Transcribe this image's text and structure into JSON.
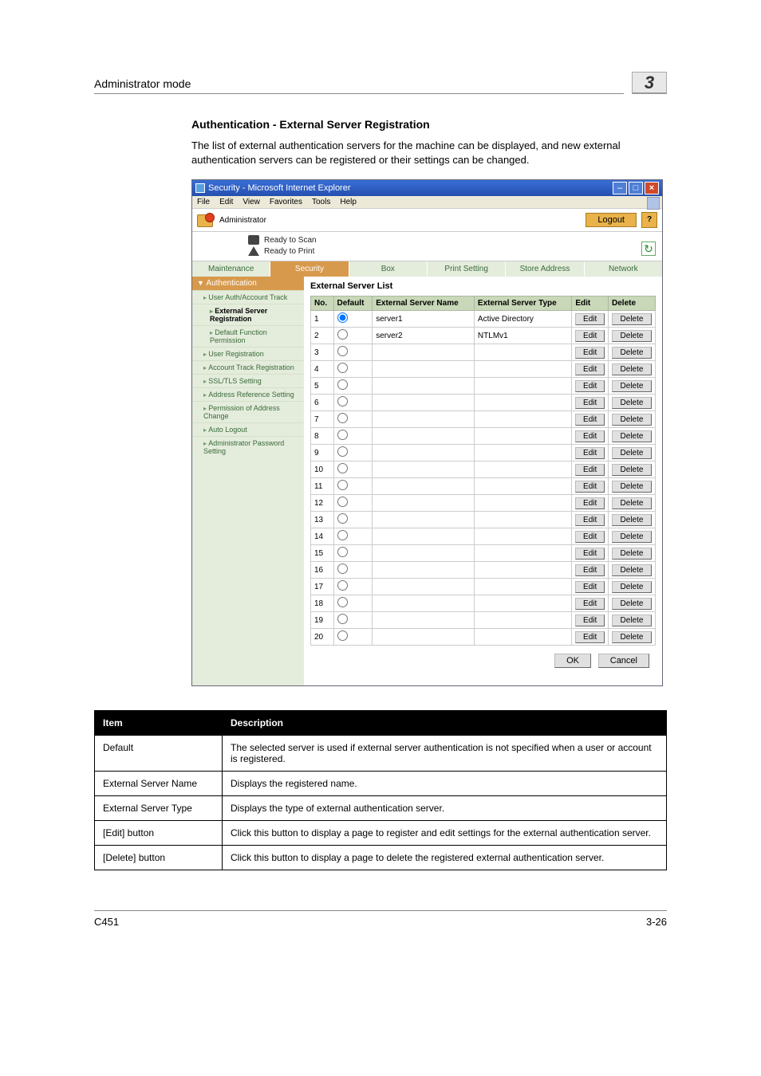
{
  "header": {
    "mode_title": "Administrator mode",
    "chapter": "3"
  },
  "section": {
    "title": "Authentication - External Server Registration",
    "intro": "The list of external authentication servers for the machine can be displayed, and new external authentication servers can be registered or their settings can be changed."
  },
  "iewin": {
    "title": "Security - Microsoft Internet Explorer",
    "menus": [
      "File",
      "Edit",
      "View",
      "Favorites",
      "Tools",
      "Help"
    ],
    "top": {
      "admin_label": "Administrator",
      "logout": "Logout",
      "help_label": "?"
    },
    "status": {
      "scan": "Ready to Scan",
      "print": "Ready to Print",
      "refresh": "↻"
    },
    "tabs": {
      "items": [
        "Maintenance",
        "Security",
        "Box",
        "Print Setting",
        "Store Address",
        "Network"
      ],
      "active": 1
    },
    "sidenav": {
      "header": "Authentication",
      "items": [
        {
          "label": "User Auth/Account Track",
          "sub": false,
          "active": false
        },
        {
          "label": "External Server Registration",
          "sub": true,
          "active": true
        },
        {
          "label": "Default Function Permission",
          "sub": true,
          "active": false
        },
        {
          "label": "User Registration",
          "sub": false,
          "active": false
        },
        {
          "label": "Account Track Registration",
          "sub": false,
          "active": false
        },
        {
          "label": "SSL/TLS Setting",
          "sub": false,
          "active": false
        },
        {
          "label": "Address Reference Setting",
          "sub": false,
          "active": false
        },
        {
          "label": "Permission of Address Change",
          "sub": false,
          "active": false
        },
        {
          "label": "Auto Logout",
          "sub": false,
          "active": false
        },
        {
          "label": "Administrator Password Setting",
          "sub": false,
          "active": false
        }
      ]
    },
    "detail": {
      "title": "External Server List",
      "cols": {
        "no": "No.",
        "def": "Default",
        "name": "External Server Name",
        "type": "External Server Type",
        "edit": "Edit",
        "del": "Delete"
      },
      "edit_label": "Edit",
      "delete_label": "Delete",
      "rows": [
        {
          "no": 1,
          "selected": true,
          "name": "server1",
          "type": "Active Directory"
        },
        {
          "no": 2,
          "selected": false,
          "name": "server2",
          "type": "NTLMv1"
        },
        {
          "no": 3,
          "selected": false,
          "name": "",
          "type": ""
        },
        {
          "no": 4,
          "selected": false,
          "name": "",
          "type": ""
        },
        {
          "no": 5,
          "selected": false,
          "name": "",
          "type": ""
        },
        {
          "no": 6,
          "selected": false,
          "name": "",
          "type": ""
        },
        {
          "no": 7,
          "selected": false,
          "name": "",
          "type": ""
        },
        {
          "no": 8,
          "selected": false,
          "name": "",
          "type": ""
        },
        {
          "no": 9,
          "selected": false,
          "name": "",
          "type": ""
        },
        {
          "no": 10,
          "selected": false,
          "name": "",
          "type": ""
        },
        {
          "no": 11,
          "selected": false,
          "name": "",
          "type": ""
        },
        {
          "no": 12,
          "selected": false,
          "name": "",
          "type": ""
        },
        {
          "no": 13,
          "selected": false,
          "name": "",
          "type": ""
        },
        {
          "no": 14,
          "selected": false,
          "name": "",
          "type": ""
        },
        {
          "no": 15,
          "selected": false,
          "name": "",
          "type": ""
        },
        {
          "no": 16,
          "selected": false,
          "name": "",
          "type": ""
        },
        {
          "no": 17,
          "selected": false,
          "name": "",
          "type": ""
        },
        {
          "no": 18,
          "selected": false,
          "name": "",
          "type": ""
        },
        {
          "no": 19,
          "selected": false,
          "name": "",
          "type": ""
        },
        {
          "no": 20,
          "selected": false,
          "name": "",
          "type": ""
        }
      ],
      "ok": "OK",
      "cancel": "Cancel"
    }
  },
  "desc_table": {
    "head_item": "Item",
    "head_desc": "Description",
    "rows": [
      {
        "item": "Default",
        "desc": "The selected server is used if external server authentication is not specified when a user or account is registered."
      },
      {
        "item": "External Server Name",
        "desc": "Displays the registered name."
      },
      {
        "item": "External Server Type",
        "desc": "Displays the type of external authentication server."
      },
      {
        "item": "[Edit] button",
        "desc": "Click this button to display a page to register and edit settings for the external authentication server."
      },
      {
        "item": "[Delete] button",
        "desc": "Click this button to display a page to delete the registered external authentication server."
      }
    ]
  },
  "footer": {
    "left": "C451",
    "right": "3-26"
  }
}
